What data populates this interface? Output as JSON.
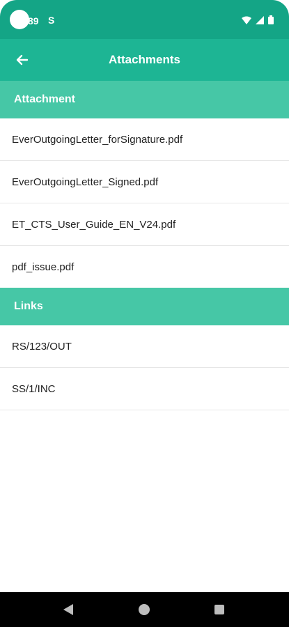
{
  "status_bar": {
    "time": "89",
    "extra_icon": "S",
    "icons": [
      "wifi-icon",
      "signal-icon",
      "battery-icon"
    ]
  },
  "app_bar": {
    "title": "Attachments",
    "back_icon": "back-arrow-icon"
  },
  "sections": {
    "attachment": {
      "header": "Attachment",
      "items": [
        "EverOutgoingLetter_forSignature.pdf",
        "EverOutgoingLetter_Signed.pdf",
        "ET_CTS_User_Guide_EN_V24.pdf",
        "pdf_issue.pdf"
      ]
    },
    "links": {
      "header": "Links",
      "items": [
        "RS/123/OUT",
        "SS/1/INC"
      ]
    }
  },
  "colors": {
    "status_bar": "#14a586",
    "app_bar": "#1db594",
    "section_header": "#46c7a6",
    "nav_bar": "#000000"
  },
  "nav_bar": {
    "buttons": [
      "nav-back-icon",
      "nav-home-icon",
      "nav-recents-icon"
    ]
  }
}
